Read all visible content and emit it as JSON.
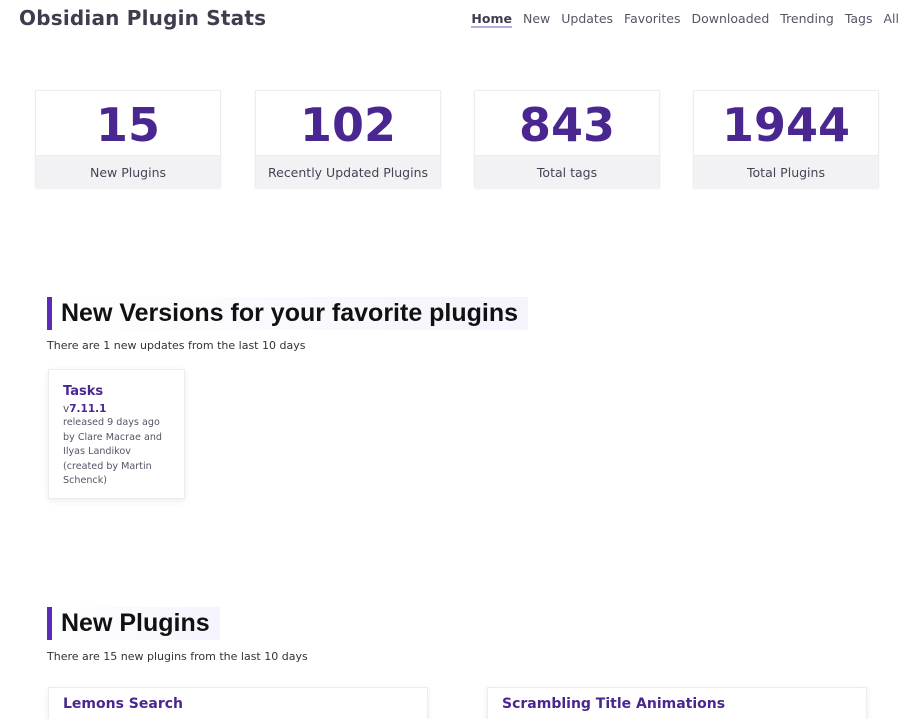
{
  "header": {
    "title": "Obsidian Plugin Stats",
    "nav": [
      "Home",
      "New",
      "Updates",
      "Favorites",
      "Downloaded",
      "Trending",
      "Tags",
      "All"
    ],
    "active_nav": "Home"
  },
  "stats": [
    {
      "value": "15",
      "label": "New Plugins"
    },
    {
      "value": "102",
      "label": "Recently Updated Plugins"
    },
    {
      "value": "843",
      "label": "Total tags"
    },
    {
      "value": "1944",
      "label": "Total Plugins"
    }
  ],
  "favorites_section": {
    "heading": "New Versions for your favorite plugins",
    "subtext": "There are 1 new updates from the last 10 days",
    "cards": [
      {
        "name": "Tasks",
        "version_prefix": "v",
        "version": "7.11.1",
        "released": "released 9 days ago",
        "authors": "by Clare Macrae and Ilyas Landikov (created by Martin Schenck)"
      }
    ]
  },
  "new_plugins_section": {
    "heading": "New Plugins",
    "subtext": "There are 15 new plugins from the last 10 days",
    "cards": [
      {
        "name": "Lemons Search"
      },
      {
        "name": "Scrambling Title Animations"
      }
    ]
  },
  "colors": {
    "accent": "#4a2790",
    "heading_bar": "#5b2cb8",
    "stat_label_bg": "#f2f2f5"
  }
}
